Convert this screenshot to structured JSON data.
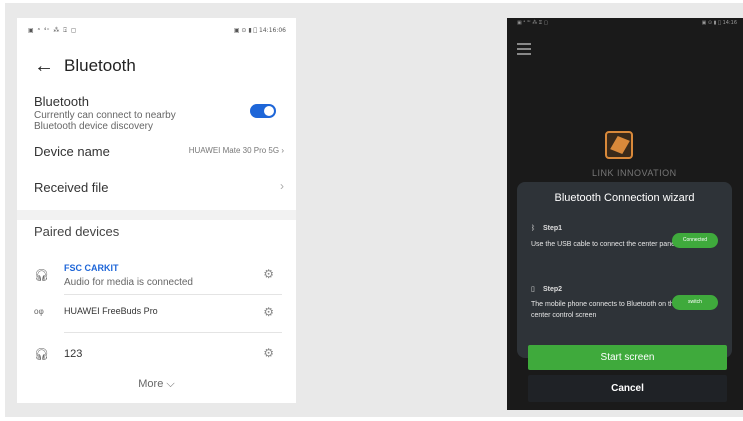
{
  "left_phone": {
    "status_left": "▣ ᵃ ⁴ᶜ ⁂ ⍐ ▢",
    "status_right": "▣ ⊙ ▮ ⃝ 14:16:06",
    "title": "Bluetooth",
    "bluetooth": {
      "label": "Bluetooth",
      "subtitle": "Currently can connect to nearby Bluetooth device discovery",
      "enabled": true
    },
    "device_name": {
      "label": "Device name",
      "value": "HUAWEI Mate 30 Pro 5G"
    },
    "received_file": {
      "label": "Received file"
    },
    "paired_header": "Paired devices",
    "devices": [
      {
        "name": "FSC CARKIT",
        "status": "Audio for media is connected",
        "icon": "headset-icon"
      },
      {
        "name": "HUAWEI FreeBuds Pro",
        "status": "",
        "icon": "earbuds-icon"
      },
      {
        "name": "123",
        "status": "",
        "icon": "headset-icon"
      }
    ],
    "more": "More ⌵",
    "accent": "#1e66d8"
  },
  "right_phone": {
    "status_left": "▣ ᵃ ⁴ᶜ ⁂ ⍐ ▢",
    "status_right": "▣ ⊙ ▮ ⃝ 14:16",
    "brand": "LINK INNOVATION",
    "wizard": {
      "title": "Bluetooth Connection wizard",
      "step1": {
        "heading": "Step1",
        "text": "Use the USB cable to connect the center panel",
        "button": "Connected"
      },
      "step2": {
        "heading": "Step2",
        "text": "The mobile phone connects to Bluetooth on the center control screen",
        "button": "switch"
      }
    },
    "start_button": "Start screen",
    "cancel_button": "Cancel",
    "accent": "#3faa3c"
  }
}
